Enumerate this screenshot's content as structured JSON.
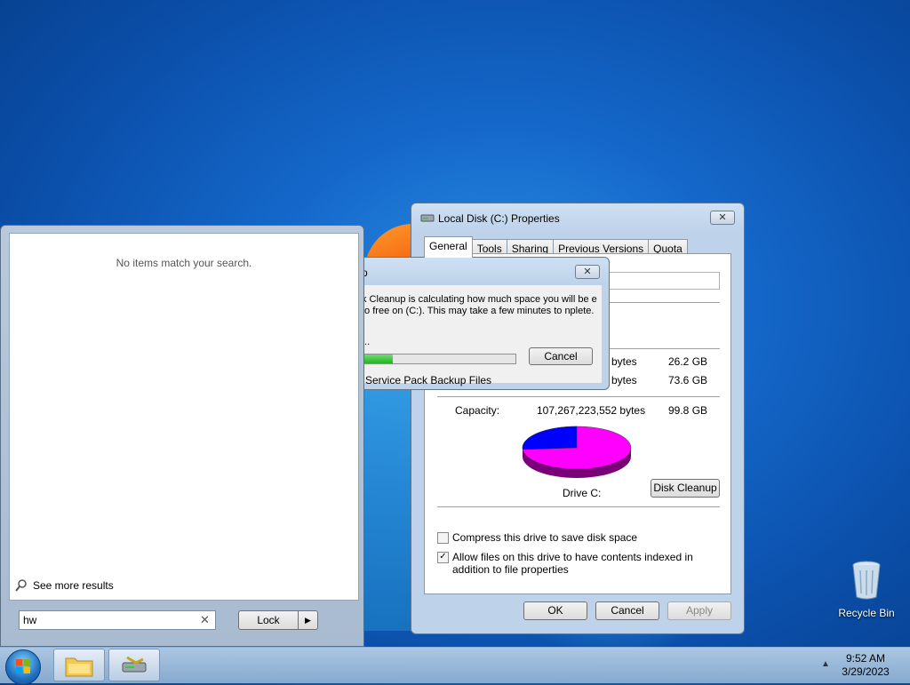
{
  "start_menu": {
    "no_items": "No items match your search.",
    "see_more": "See more results",
    "search_value": "hw",
    "lock_label": "Lock"
  },
  "properties": {
    "title": "Local Disk (C:) Properties",
    "tabs": [
      "General",
      "Tools",
      "Sharing",
      "Previous Versions",
      "Quota"
    ],
    "used_bytes_suffix": "bytes",
    "used_gb": "26.2 GB",
    "free_bytes_suffix": "bytes",
    "free_gb": "73.6 GB",
    "capacity_label": "Capacity:",
    "capacity_bytes": "107,267,223,552 bytes",
    "capacity_gb": "99.8 GB",
    "drive_label": "Drive C:",
    "disk_cleanup_label": "Disk Cleanup",
    "compress_label": "Compress this drive to save disk space",
    "compress_checked": false,
    "index_label": "Allow files on this drive to have contents indexed in addition to file properties",
    "index_checked": true,
    "ok_label": "OK",
    "cancel_label": "Cancel",
    "apply_label": "Apply",
    "used_fraction": 0.263
  },
  "disk_cleanup": {
    "title": "p",
    "message": "k Cleanup is calculating how much space you will be e to free on  (C:). This may take a few minutes to nplete.",
    "dots": "...",
    "cancel_label": "Cancel",
    "current_item": "Service Pack Backup Files",
    "progress": 0.2
  },
  "desktop": {
    "recycle_bin": "Recycle Bin"
  },
  "taskbar": {
    "time": "9:52 AM",
    "date": "3/29/2023"
  }
}
